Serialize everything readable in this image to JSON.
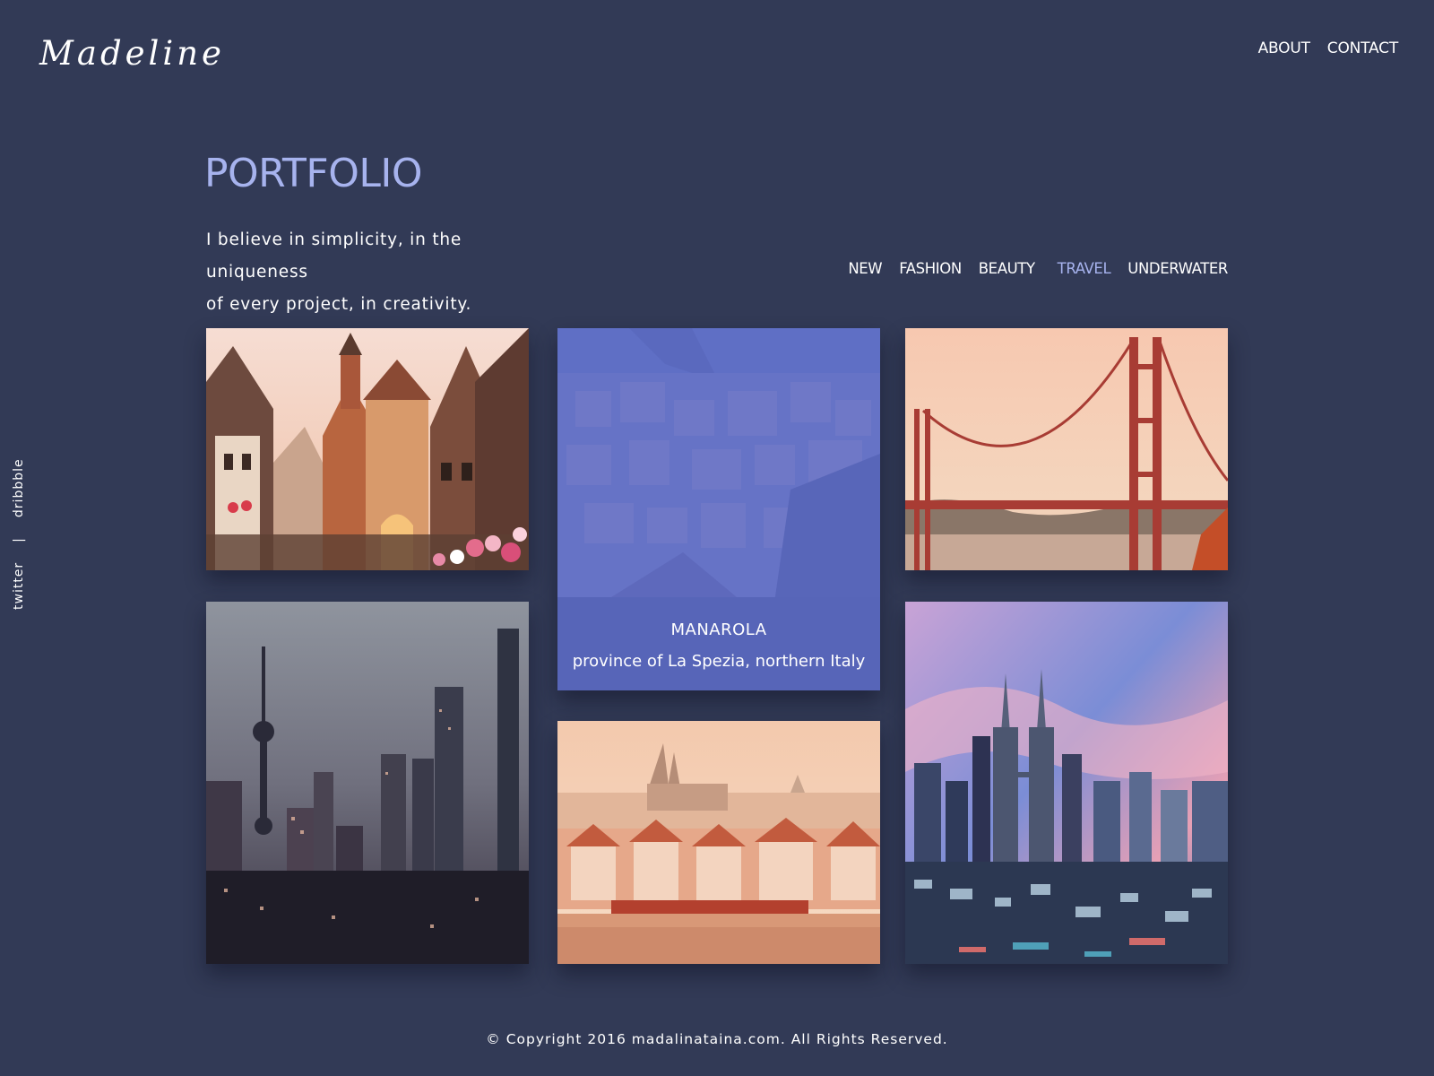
{
  "header": {
    "logo": "Madeline",
    "nav": [
      {
        "label": "ABOUT"
      },
      {
        "label": "CONTACT"
      }
    ]
  },
  "social": {
    "items": [
      {
        "label": "twitter"
      },
      {
        "label": "dribbble"
      }
    ],
    "separator": "|"
  },
  "portfolio": {
    "title": "PORTFOLIO",
    "intro_line1": "I believe in simplicity, in the uniqueness",
    "intro_line2": "of every project, in creativity.",
    "filters": [
      {
        "label": "NEW",
        "active": false
      },
      {
        "label": "FASHION",
        "active": false
      },
      {
        "label": "BEAUTY",
        "active": false
      },
      {
        "label": "TRAVEL",
        "active": true
      },
      {
        "label": "UNDERWATER",
        "active": false
      }
    ],
    "gallery": [
      {
        "name": "old-town-street-photo"
      },
      {
        "name": "manarola-photo",
        "overlay_title": "MANAROLA",
        "overlay_subtitle": "province of La Spezia, northern Italy"
      },
      {
        "name": "golden-gate-bridge-photo"
      },
      {
        "name": "shanghai-skyline-photo"
      },
      {
        "name": "prague-castle-photo"
      },
      {
        "name": "kuala-lumpur-skyline-photo"
      }
    ]
  },
  "colors": {
    "background": "#323a56",
    "accent": "#a7b3ee",
    "overlay": "#5b6ccd"
  },
  "footer": {
    "copyright": "© Copyright 2016 madalinataina.com. All Rights Reserved."
  }
}
